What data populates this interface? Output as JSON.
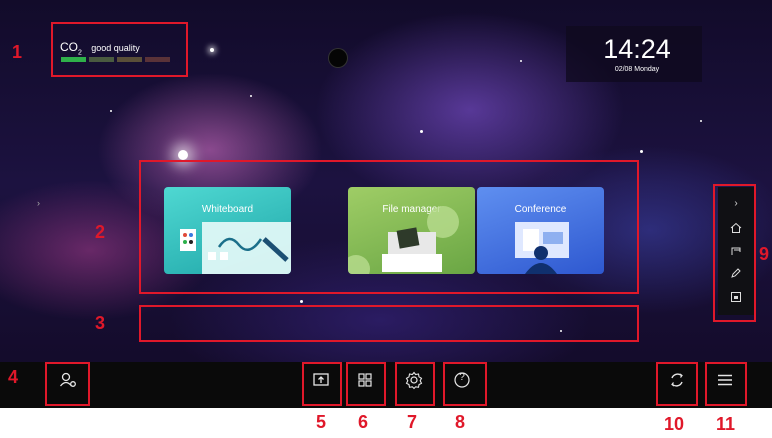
{
  "status": {
    "co2_label": "CO",
    "co2_sub": "2",
    "quality": "good quality",
    "bar_colors": [
      "#2fb04a",
      "#4a5a40",
      "#5a4e38",
      "#5a3238"
    ]
  },
  "clock": {
    "time": "14:24",
    "date": "02/08 Monday"
  },
  "apps": [
    {
      "label": "Whiteboard",
      "color": "#3ec8c4"
    },
    {
      "label": "File manager",
      "color": "#8bbf5a"
    },
    {
      "label": "Conference",
      "color": "#4a7ae8"
    }
  ],
  "sidebar": {
    "icons": [
      "chevron-right-icon",
      "home-icon",
      "back-icon",
      "pen-icon",
      "floating-window-icon"
    ]
  },
  "taskbar": {
    "icons": [
      "user-settings-icon",
      "screen-share-icon",
      "apps-grid-icon",
      "settings-icon",
      "help-icon",
      "refresh-icon",
      "menu-icon"
    ],
    "help_glyph": "?"
  },
  "callouts": [
    "1",
    "2",
    "3",
    "4",
    "5",
    "6",
    "7",
    "8",
    "9",
    "10",
    "11"
  ],
  "accent_color": "#e0182a"
}
